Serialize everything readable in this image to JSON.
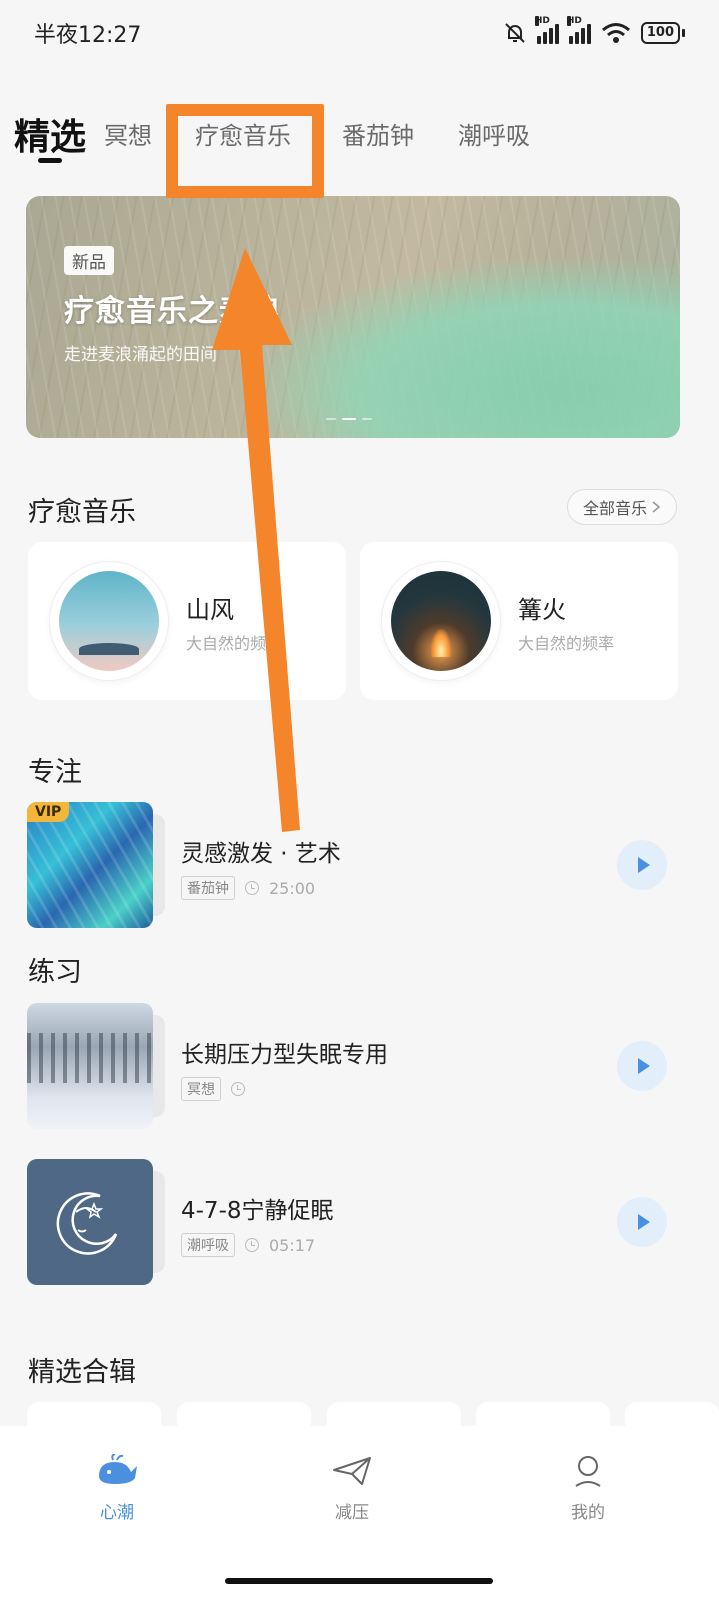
{
  "status_bar": {
    "time": "半夜12:27",
    "battery": "100"
  },
  "tabs": [
    {
      "label": "精选",
      "active": true
    },
    {
      "label": "冥想",
      "active": false
    },
    {
      "label": "疗愈音乐",
      "active": false
    },
    {
      "label": "番茄钟",
      "active": false
    },
    {
      "label": "潮呼吸",
      "active": false
    }
  ],
  "banner": {
    "badge": "新品",
    "title": "疗愈音乐之麦浪",
    "subtitle": "走进麦浪涌起的田间"
  },
  "healing_music": {
    "title": "疗愈音乐",
    "all_button": "全部音乐",
    "cards": [
      {
        "name": "山风",
        "desc": "大自然的频率"
      },
      {
        "name": "篝火",
        "desc": "大自然的频率"
      }
    ]
  },
  "focus": {
    "title": "专注",
    "items": [
      {
        "title": "灵感激发 · 艺术",
        "tag": "番茄钟",
        "duration": "25:00",
        "vip": "VIP"
      }
    ]
  },
  "practice": {
    "title": "练习",
    "items": [
      {
        "title": "长期压力型失眠专用",
        "tag": "冥想",
        "duration": ""
      },
      {
        "title": "4-7-8宁静促眠",
        "tag": "潮呼吸",
        "duration": "05:17"
      }
    ]
  },
  "collections": {
    "title": "精选合辑"
  },
  "bottom_nav": [
    {
      "label": "心潮",
      "icon": "whale-icon",
      "active": true
    },
    {
      "label": "减压",
      "icon": "paper-plane-icon",
      "active": false
    },
    {
      "label": "我的",
      "icon": "person-icon",
      "active": false
    }
  ],
  "colors": {
    "accent": "#4a8fe0",
    "annotation": "#f5852a",
    "vip": "#f2b73a"
  }
}
